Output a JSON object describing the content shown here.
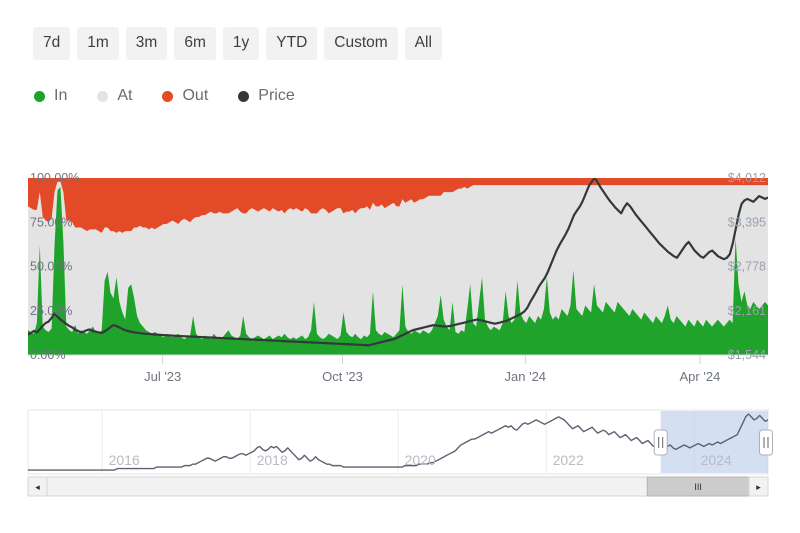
{
  "range_selector": {
    "buttons": [
      {
        "label": "7d",
        "selected": false
      },
      {
        "label": "1m",
        "selected": false
      },
      {
        "label": "3m",
        "selected": false
      },
      {
        "label": "6m",
        "selected": false
      },
      {
        "label": "1y",
        "selected": false
      },
      {
        "label": "YTD",
        "selected": false
      },
      {
        "label": "Custom",
        "selected": false
      },
      {
        "label": "All",
        "selected": false
      }
    ]
  },
  "legend": {
    "items": [
      {
        "label": "In",
        "color": "#1fa32a"
      },
      {
        "label": "At",
        "color": "#e3e3e3"
      },
      {
        "label": "Out",
        "color": "#e34a28"
      },
      {
        "label": "Price",
        "color": "#33383d"
      }
    ]
  },
  "chart_data": {
    "type": "area",
    "title": "",
    "xlabel": "",
    "ylabel": "",
    "y_left_ticks": [
      "0.00%",
      "25.00%",
      "50.00%",
      "75.00%",
      "100.00%"
    ],
    "y_left_values": [
      0,
      25,
      50,
      75,
      100
    ],
    "ylim": [
      0,
      100
    ],
    "y_right_ticks": [
      "$1,544",
      "$2,161",
      "$2,778",
      "$3,395",
      "$4,012"
    ],
    "y_right_values": [
      1544,
      2161,
      2778,
      3395,
      4012
    ],
    "y_right_lim": [
      1544,
      4012
    ],
    "x_ticks": [
      "Jul '23",
      "Oct '23",
      "Jan '24",
      "Apr '24"
    ],
    "x_tick_positions": [
      0.182,
      0.425,
      0.672,
      0.908
    ],
    "grid": false,
    "legend_position": "top-left",
    "stacked": true,
    "series": [
      {
        "name": "In",
        "color": "#1fa32a",
        "values": [
          14,
          13,
          12,
          18,
          62,
          16,
          14,
          13,
          15,
          62,
          93,
          95,
          64,
          16,
          14,
          13,
          17,
          12,
          14,
          13,
          12,
          14,
          16,
          13,
          12,
          14,
          42,
          47,
          35,
          32,
          44,
          30,
          24,
          20,
          38,
          40,
          32,
          22,
          18,
          16,
          14,
          13,
          12,
          13,
          12,
          11,
          10,
          12,
          11,
          10,
          11,
          12,
          10,
          9,
          10,
          11,
          22,
          12,
          10,
          9,
          11,
          10,
          9,
          12,
          10,
          9,
          10,
          12,
          14,
          11,
          10,
          9,
          11,
          22,
          12,
          10,
          9,
          10,
          11,
          10,
          9,
          10,
          11,
          9,
          10,
          11,
          10,
          12,
          10,
          9,
          10,
          9,
          10,
          11,
          9,
          10,
          14,
          30,
          12,
          10,
          9,
          10,
          12,
          11,
          10,
          9,
          11,
          24,
          13,
          11,
          10,
          12,
          10,
          9,
          11,
          10,
          12,
          36,
          14,
          12,
          11,
          13,
          12,
          11,
          10,
          12,
          14,
          40,
          16,
          13,
          12,
          14,
          13,
          12,
          14,
          13,
          12,
          14,
          18,
          22,
          34,
          20,
          16,
          14,
          30,
          13,
          12,
          14,
          13,
          26,
          40,
          18,
          16,
          30,
          44,
          20,
          16,
          14,
          16,
          15,
          14,
          18,
          36,
          22,
          18,
          20,
          42,
          24,
          20,
          18,
          22,
          20,
          18,
          22,
          20,
          26,
          44,
          24,
          20,
          22,
          20,
          26,
          24,
          22,
          28,
          48,
          26,
          24,
          22,
          28,
          26,
          24,
          40,
          28,
          26,
          24,
          30,
          28,
          26,
          24,
          30,
          28,
          26,
          24,
          22,
          26,
          24,
          22,
          20,
          24,
          22,
          20,
          18,
          22,
          20,
          18,
          22,
          28,
          20,
          18,
          22,
          20,
          18,
          16,
          20,
          18,
          16,
          20,
          18,
          16,
          20,
          18,
          16,
          18,
          20,
          18,
          16,
          18,
          20,
          18,
          66,
          40,
          30,
          36,
          28,
          26,
          30,
          28,
          26,
          28,
          30,
          28
        ]
      },
      {
        "name": "At",
        "color": "#e3e3e3",
        "values": [
          70,
          70,
          70,
          64,
          30,
          62,
          62,
          62,
          62,
          30,
          5,
          3,
          28,
          60,
          62,
          62,
          55,
          60,
          58,
          58,
          58,
          57,
          55,
          58,
          58,
          55,
          30,
          25,
          35,
          38,
          25,
          40,
          45,
          50,
          32,
          30,
          40,
          50,
          55,
          56,
          58,
          58,
          60,
          58,
          60,
          62,
          64,
          62,
          64,
          66,
          64,
          62,
          66,
          68,
          66,
          64,
          55,
          66,
          68,
          70,
          68,
          70,
          72,
          68,
          70,
          72,
          70,
          68,
          66,
          70,
          72,
          74,
          70,
          58,
          68,
          72,
          74,
          72,
          70,
          72,
          74,
          72,
          70,
          74,
          72,
          70,
          72,
          68,
          72,
          74,
          72,
          74,
          72,
          70,
          74,
          72,
          66,
          50,
          68,
          72,
          74,
          72,
          68,
          70,
          72,
          74,
          72,
          56,
          68,
          70,
          72,
          68,
          72,
          74,
          72,
          74,
          70,
          50,
          70,
          72,
          74,
          70,
          72,
          74,
          76,
          72,
          70,
          48,
          70,
          74,
          76,
          72,
          74,
          76,
          74,
          76,
          78,
          76,
          72,
          68,
          56,
          72,
          76,
          78,
          62,
          80,
          82,
          80,
          82,
          68,
          55,
          78,
          80,
          66,
          52,
          76,
          80,
          82,
          80,
          81,
          82,
          78,
          60,
          74,
          78,
          76,
          54,
          72,
          76,
          78,
          74,
          76,
          78,
          74,
          76,
          70,
          52,
          72,
          76,
          74,
          76,
          70,
          72,
          74,
          68,
          48,
          70,
          72,
          74,
          68,
          70,
          72,
          56,
          68,
          70,
          72,
          66,
          68,
          70,
          72,
          66,
          68,
          70,
          72,
          74,
          70,
          72,
          74,
          76,
          72,
          74,
          76,
          78,
          74,
          76,
          78,
          74,
          68,
          76,
          78,
          74,
          76,
          78,
          80,
          76,
          78,
          80,
          76,
          78,
          80,
          76,
          78,
          80,
          78,
          76,
          78,
          80,
          78,
          76,
          78,
          30,
          56,
          66,
          60,
          68,
          70,
          66,
          68,
          70,
          68,
          66,
          68
        ]
      },
      {
        "name": "Out",
        "color": "#e34a28",
        "values": [
          16,
          17,
          18,
          18,
          8,
          22,
          24,
          25,
          23,
          8,
          2,
          2,
          8,
          24,
          24,
          25,
          28,
          28,
          28,
          29,
          30,
          29,
          29,
          29,
          30,
          31,
          28,
          28,
          30,
          30,
          31,
          30,
          31,
          30,
          30,
          30,
          28,
          28,
          27,
          28,
          28,
          29,
          28,
          29,
          28,
          27,
          26,
          26,
          25,
          24,
          25,
          26,
          24,
          23,
          24,
          25,
          23,
          22,
          22,
          21,
          21,
          20,
          19,
          20,
          20,
          19,
          20,
          20,
          20,
          19,
          18,
          17,
          19,
          20,
          20,
          18,
          17,
          18,
          19,
          18,
          17,
          18,
          19,
          17,
          18,
          19,
          18,
          20,
          18,
          17,
          18,
          17,
          18,
          19,
          17,
          18,
          20,
          20,
          20,
          18,
          17,
          18,
          20,
          19,
          18,
          17,
          17,
          20,
          19,
          19,
          18,
          20,
          18,
          17,
          17,
          16,
          18,
          14,
          16,
          16,
          15,
          17,
          16,
          15,
          14,
          16,
          16,
          12,
          14,
          13,
          12,
          14,
          13,
          12,
          12,
          11,
          10,
          10,
          10,
          10,
          10,
          8,
          8,
          8,
          8,
          7,
          6,
          6,
          5,
          6,
          5,
          4,
          4,
          4,
          4,
          4,
          4,
          4,
          4,
          4,
          4,
          4,
          4,
          4,
          4,
          4,
          4,
          4,
          4,
          4,
          4,
          4,
          4,
          4,
          4,
          4,
          4,
          4,
          4,
          4,
          4,
          4,
          4,
          4,
          4,
          4,
          4,
          4,
          4,
          4,
          4,
          4,
          4,
          4,
          4,
          4,
          4,
          4,
          4,
          4,
          4,
          4,
          4,
          4,
          4,
          4,
          4,
          4,
          4,
          4,
          4,
          4,
          4,
          4,
          4,
          4,
          4,
          4,
          4,
          4,
          4,
          4,
          4,
          4,
          4,
          4,
          4,
          4,
          4,
          4,
          4,
          4,
          4,
          4,
          4,
          4,
          4,
          4,
          4,
          4,
          4,
          4,
          4,
          4,
          4,
          4,
          4,
          4,
          4,
          4
        ]
      },
      {
        "name": "Price",
        "color": "#33383d",
        "axis": "right",
        "values": [
          1830,
          1850,
          1880,
          1860,
          1900,
          1950,
          1990,
          2010,
          2060,
          2120,
          2080,
          2040,
          2010,
          1980,
          1950,
          1930,
          1900,
          1880,
          1860,
          1870,
          1890,
          1900,
          1880,
          1870,
          1860,
          1850,
          1870,
          1900,
          1930,
          1960,
          1950,
          1930,
          1910,
          1890,
          1880,
          1870,
          1860,
          1855,
          1850,
          1845,
          1840,
          1838,
          1835,
          1830,
          1828,
          1825,
          1822,
          1820,
          1818,
          1815,
          1812,
          1810,
          1808,
          1806,
          1804,
          1802,
          1800,
          1798,
          1796,
          1794,
          1792,
          1790,
          1788,
          1786,
          1784,
          1782,
          1780,
          1778,
          1776,
          1774,
          1772,
          1770,
          1768,
          1766,
          1764,
          1762,
          1760,
          1758,
          1756,
          1754,
          1752,
          1750,
          1748,
          1746,
          1744,
          1742,
          1740,
          1738,
          1736,
          1734,
          1732,
          1730,
          1728,
          1726,
          1724,
          1722,
          1720,
          1718,
          1716,
          1714,
          1712,
          1710,
          1708,
          1706,
          1704,
          1702,
          1700,
          1698,
          1696,
          1694,
          1692,
          1690,
          1688,
          1686,
          1684,
          1682,
          1680,
          1690,
          1700,
          1710,
          1720,
          1730,
          1740,
          1750,
          1760,
          1770,
          1790,
          1810,
          1830,
          1850,
          1870,
          1890,
          1900,
          1910,
          1920,
          1930,
          1940,
          1950,
          1960,
          1955,
          1950,
          1945,
          1940,
          1945,
          1950,
          1960,
          1970,
          1980,
          1990,
          2000,
          2010,
          2020,
          2030,
          2040,
          2030,
          2020,
          2010,
          2000,
          1990,
          1980,
          1990,
          2000,
          2010,
          2020,
          2040,
          2060,
          2080,
          2100,
          2120,
          2150,
          2200,
          2280,
          2350,
          2420,
          2500,
          2560,
          2620,
          2700,
          2800,
          2900,
          3000,
          3080,
          3150,
          3220,
          3300,
          3400,
          3500,
          3560,
          3620,
          3700,
          3800,
          3900,
          3960,
          4012,
          3950,
          3880,
          3820,
          3760,
          3700,
          3650,
          3600,
          3560,
          3520,
          3600,
          3660,
          3620,
          3560,
          3500,
          3450,
          3400,
          3350,
          3300,
          3250,
          3200,
          3150,
          3100,
          3060,
          3020,
          2980,
          2950,
          2920,
          2900,
          2960,
          3020,
          3080,
          3120,
          3060,
          3000,
          2960,
          2920,
          2900,
          2940,
          2980,
          3000,
          2960,
          2920,
          2900,
          2880,
          2900,
          2950,
          3100,
          3300,
          3500,
          3650,
          3700,
          3720,
          3700,
          3680,
          3720,
          3760,
          3740,
          3720,
          3740
        ]
      }
    ]
  },
  "navigator": {
    "year_labels": [
      "2016",
      "2018",
      "2020",
      "2022",
      "2024"
    ],
    "year_positions": [
      0.13,
      0.33,
      0.53,
      0.73,
      0.93
    ],
    "selection": {
      "start": 0.855,
      "end": 1.0
    },
    "series_name": "Price",
    "series_color": "#5b6270",
    "series_values": [
      40,
      40,
      40,
      40,
      40,
      40,
      40,
      40,
      40,
      40,
      40,
      40,
      40,
      40,
      40,
      40,
      40,
      40,
      40,
      40,
      40,
      40,
      40,
      40,
      40,
      40,
      40,
      40,
      40,
      40,
      40,
      40,
      39,
      39,
      39,
      39,
      39,
      39,
      39,
      39,
      39,
      39,
      39,
      39,
      39,
      39,
      38,
      38,
      38,
      38,
      38,
      38,
      38,
      38,
      38,
      38,
      37,
      37,
      37,
      36,
      36,
      35,
      34,
      33,
      32,
      32,
      33,
      34,
      33,
      32,
      31,
      31,
      32,
      32,
      31,
      30,
      29,
      29,
      30,
      29,
      28,
      27,
      25,
      24,
      26,
      27,
      26,
      24,
      25,
      24,
      26,
      28,
      27,
      25,
      27,
      29,
      31,
      33,
      32,
      30,
      32,
      34,
      33,
      31,
      33,
      34,
      35,
      36,
      36,
      37,
      37,
      37,
      37,
      38,
      38,
      38,
      38,
      38,
      38,
      38,
      38,
      38,
      38,
      38,
      38,
      38,
      38,
      38,
      38,
      38,
      38,
      38,
      38,
      38,
      38,
      37,
      37,
      37,
      37,
      37,
      36,
      36,
      36,
      36,
      35,
      35,
      34,
      33,
      32,
      31,
      30,
      29,
      28,
      27,
      25,
      23,
      22,
      21,
      20,
      19,
      19,
      18,
      17,
      16,
      15,
      14,
      15,
      14,
      13,
      12,
      11,
      10,
      11,
      10,
      12,
      13,
      11,
      9,
      8,
      9,
      8,
      7,
      6,
      7,
      8,
      9,
      8,
      7,
      6,
      5,
      4,
      5,
      6,
      8,
      10,
      12,
      11,
      10,
      12,
      14,
      13,
      12,
      11,
      13,
      15,
      14,
      13,
      14,
      16,
      15,
      14,
      16,
      18,
      17,
      16,
      18,
      20,
      19,
      18,
      20,
      22,
      21,
      20,
      22,
      24,
      23,
      22,
      23,
      25,
      24,
      23,
      25,
      26,
      25,
      24,
      23,
      24,
      25,
      24,
      23,
      22,
      23,
      24,
      23,
      22,
      23,
      22,
      21,
      22,
      21,
      20,
      19,
      18,
      17,
      16,
      12,
      8,
      4,
      2,
      4,
      6,
      5,
      3,
      5,
      7,
      6
    ]
  },
  "scrollbar": {
    "left_arrow": "◂",
    "right_arrow": "▸",
    "thumb_grip": "III",
    "thumb_start": 0.855,
    "thumb_end": 1.0
  }
}
